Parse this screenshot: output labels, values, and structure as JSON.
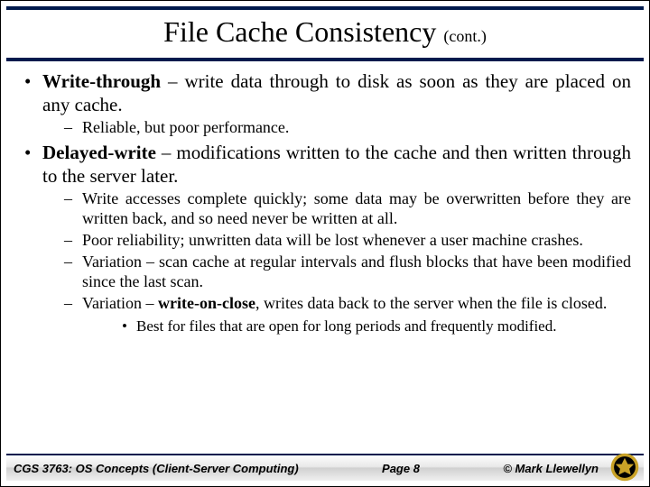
{
  "title": "File Cache Consistency",
  "title_suffix": "(cont.)",
  "bullets": [
    {
      "lead": "Write-through",
      "rest": " – write data through to disk as soon as they are placed on any cache.",
      "subs": [
        {
          "text": "Reliable, but poor performance."
        }
      ]
    },
    {
      "lead": "Delayed-write",
      "rest": " – modifications written to the cache and then written through to the server later.",
      "subs": [
        {
          "text": " Write accesses complete quickly; some data may be overwritten before they are written back, and so need never be written at all."
        },
        {
          "text": "Poor reliability; unwritten data will be lost whenever a user machine crashes."
        },
        {
          "text": "Variation – scan cache at regular intervals and flush blocks that have been modified since the last scan."
        },
        {
          "pre": "Variation – ",
          "bold": "write-on-close",
          "post": ", writes data back to the server when the file is closed.",
          "subsubs": [
            {
              "text": "Best for files that are open for long periods and frequently modified."
            }
          ]
        }
      ]
    }
  ],
  "footer": {
    "course": "CGS 3763: OS Concepts (Client-Server Computing)",
    "page": "Page 8",
    "author": "© Mark Llewellyn"
  }
}
